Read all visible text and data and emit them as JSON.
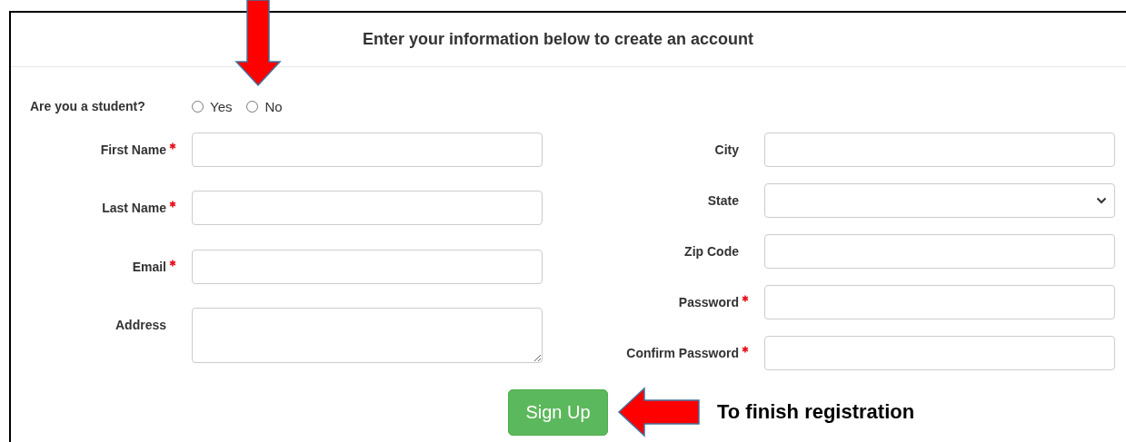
{
  "heading": "Enter your information below to create an account",
  "student_question": {
    "label": "Are you a student?",
    "options": [
      {
        "label": "Yes",
        "selected": false
      },
      {
        "label": "No",
        "selected": false
      }
    ]
  },
  "left_fields": [
    {
      "label": "First Name",
      "required": true,
      "kind": "text"
    },
    {
      "label": "Last Name",
      "required": true,
      "kind": "text"
    },
    {
      "label": "Email",
      "required": true,
      "kind": "text"
    },
    {
      "label": "Address",
      "required": false,
      "kind": "textarea"
    }
  ],
  "right_fields": [
    {
      "label": "City",
      "required": false,
      "kind": "text"
    },
    {
      "label": "State",
      "required": false,
      "kind": "select"
    },
    {
      "label": "Zip Code",
      "required": false,
      "kind": "text"
    },
    {
      "label": "Password",
      "required": true,
      "kind": "text"
    },
    {
      "label": "Confirm Password",
      "required": true,
      "kind": "text"
    }
  ],
  "submit_button": "Sign Up",
  "annotation": "To finish registration"
}
